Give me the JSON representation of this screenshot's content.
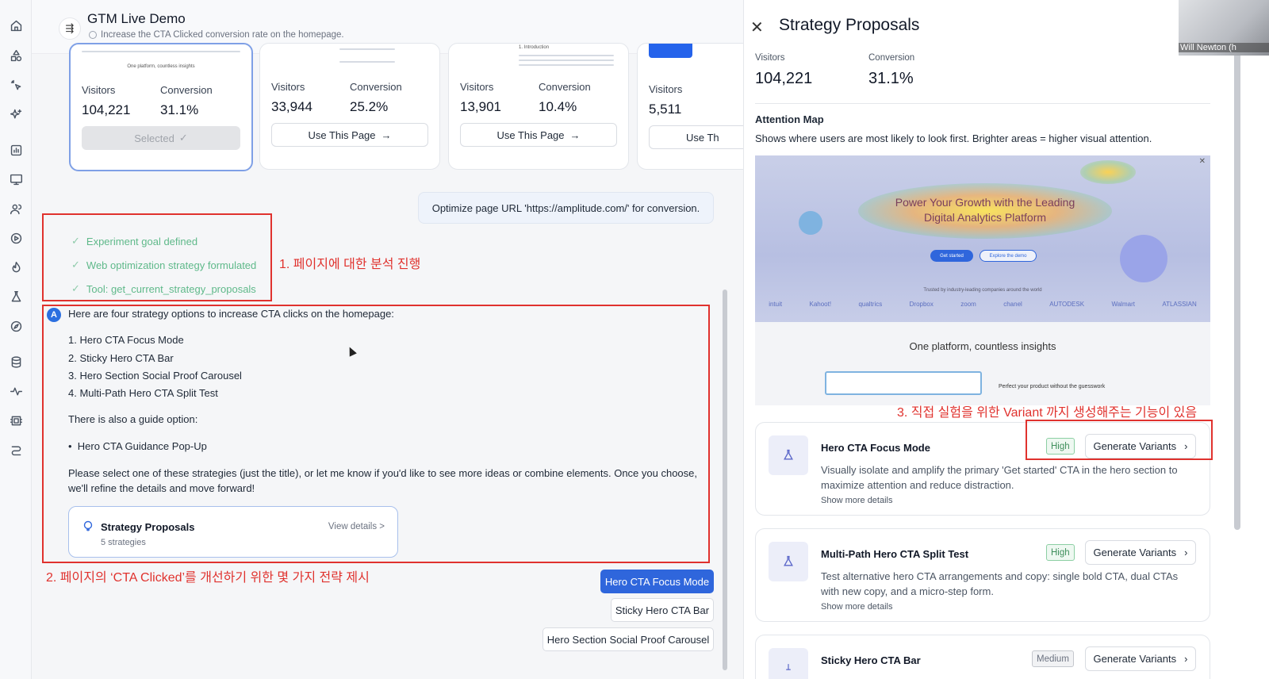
{
  "header": {
    "title": "GTM Live Demo",
    "subtitle": "Increase the CTA Clicked conversion rate on the homepage."
  },
  "page_cards": [
    {
      "visitors_label": "Visitors",
      "visitors": "104,221",
      "conversion_label": "Conversion",
      "conversion": "31.1%",
      "button": "Selected",
      "thumb_caption": "One platform, countless insights"
    },
    {
      "visitors_label": "Visitors",
      "visitors": "33,944",
      "conversion_label": "Conversion",
      "conversion": "25.2%",
      "button": "Use This Page"
    },
    {
      "visitors_label": "Visitors",
      "visitors": "13,901",
      "conversion_label": "Conversion",
      "conversion": "10.4%",
      "button": "Use This Page",
      "thumb_caption": "1. Introduction"
    },
    {
      "visitors_label": "Visitors",
      "visitors": "5,511",
      "button": "Use Th"
    }
  ],
  "user_message": "Optimize page URL 'https://amplitude.com/' for conversion.",
  "steps": [
    "Experiment goal defined",
    "Web optimization strategy formulated",
    "Tool: get_current_strategy_proposals"
  ],
  "assistant": {
    "intro": "Here are four strategy options to increase CTA clicks on the homepage:",
    "options": [
      "1. Hero CTA Focus Mode",
      "2. Sticky Hero CTA Bar",
      "3. Hero Section Social Proof Carousel",
      "4. Multi-Path Hero CTA Split Test"
    ],
    "guide_intro": "There is also a guide option:",
    "guide_option": "Hero CTA Guidance Pop-Up",
    "closing": "Please select one of these strategies (just the title), or let me know if you'd like to see more ideas or combine elements. Once you choose, we'll refine the details and move forward!",
    "proposals_card": {
      "title": "Strategy Proposals",
      "sub": "5 strategies",
      "link": "View details >"
    }
  },
  "chips": [
    "Hero CTA Focus Mode",
    "Sticky Hero CTA Bar",
    "Hero Section Social Proof Carousel"
  ],
  "annotations": {
    "a1": "1. 페이지에 대한 분석 진행",
    "a2": "2. 페이지의 ‘CTA Clicked’를 개선하기 위한 몇 가지 전략 제시",
    "a3": "3. 직접 실험을 위한 Variant 까지 생성해주는 기능이 있음"
  },
  "panel": {
    "title": "Strategy Proposals",
    "visitors_label": "Visitors",
    "visitors": "104,221",
    "conversion_label": "Conversion",
    "conversion": "31.1%",
    "attention_title": "Attention Map",
    "attention_desc": "Shows where users are most likely to look first. Brighter areas = higher visual attention.",
    "heatmap": {
      "headline_1": "Power Your Growth with the Leading",
      "headline_2": "Digital Analytics Platform",
      "cta_primary": "Get started",
      "cta_secondary": "Explore the demo",
      "trusted": "Trusted by industry-leading companies around the world",
      "logos": [
        "intuit",
        "Kahoot!",
        "qualtrics",
        "Dropbox",
        "zoom",
        "chanel",
        "AUTODESK",
        "Walmart",
        "ATLASSIAN"
      ],
      "tagline": "One platform, countless insights",
      "sub_caption": "Perfect your product without the guesswork"
    },
    "strategies": [
      {
        "title": "Hero CTA Focus Mode",
        "badge": "High",
        "button": "Generate Variants",
        "desc": "Visually isolate and amplify the primary 'Get started' CTA in the hero section to maximize attention and reduce distraction.",
        "more": "Show more details"
      },
      {
        "title": "Multi-Path Hero CTA Split Test",
        "badge": "High",
        "button": "Generate Variants",
        "desc": "Test alternative hero CTA arrangements and copy: single bold CTA, dual CTAs with new copy, and a micro-step form.",
        "more": "Show more details"
      },
      {
        "title": "Sticky Hero CTA Bar",
        "badge": "Medium",
        "button": "Generate Variants"
      }
    ]
  },
  "presenter_name": "Will Newton (h",
  "colors": {
    "accent": "#2f66dc",
    "success": "#5fb98a",
    "annotation": "#e0322e"
  }
}
